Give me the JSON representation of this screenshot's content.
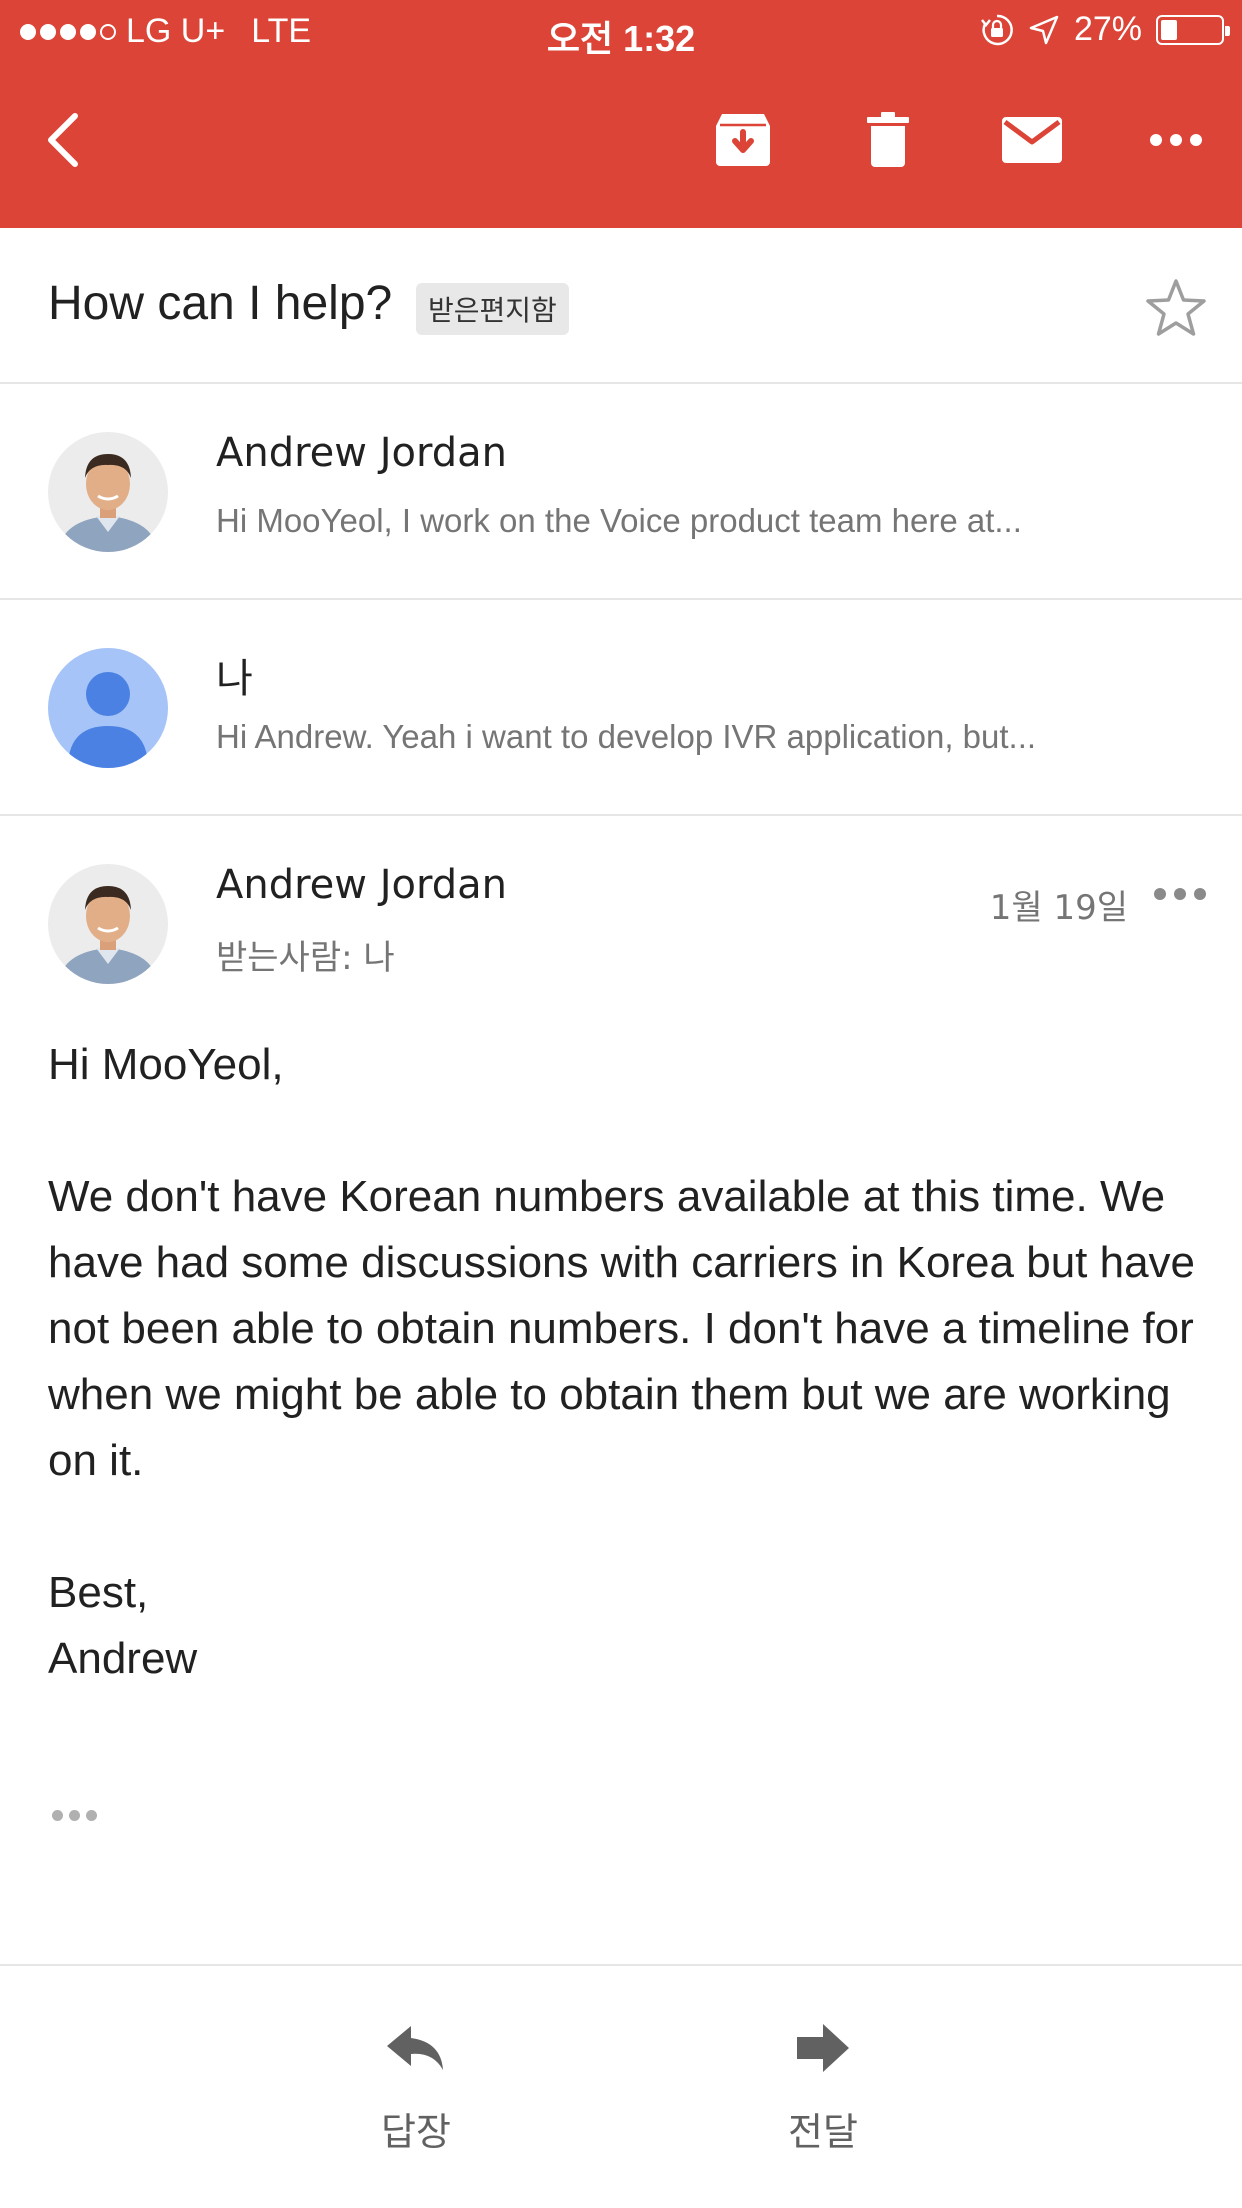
{
  "status_bar": {
    "carrier": "LG U+",
    "network": "LTE",
    "time": "오전 1:32",
    "battery_percent": "27%",
    "battery_level": 0.27,
    "signal_bars_filled": 4,
    "signal_bars_total": 5
  },
  "toolbar": {
    "icons": [
      "back-arrow-icon",
      "archive-icon",
      "trash-icon",
      "mail-icon",
      "more-horizontal-icon"
    ]
  },
  "thread": {
    "subject": "How can I help?",
    "label": "받은편지함",
    "starred": false
  },
  "messages": [
    {
      "sender": "Andrew Jordan",
      "snippet": "Hi MooYeol, I work on the Voice product team here at..."
    },
    {
      "sender": "나",
      "snippet": "Hi Andrew. Yeah i want to develop IVR application, but..."
    }
  ],
  "open_message": {
    "sender": "Andrew Jordan",
    "to_line": "받는사람: 나",
    "date": "1월 19일",
    "greeting": "Hi MooYeol,",
    "body": "We don't have Korean numbers available at this time. We have had some discussions with carriers in Korea but have not been able to obtain numbers. I don't have a timeline for when we might be able to obtain them but we are working on it.",
    "closing": "Best,",
    "signature": "Andrew"
  },
  "actions": {
    "reply_label": "답장",
    "forward_label": "전달"
  },
  "colors": {
    "header": "#dc4437",
    "default_avatar_bg": "#a6c4f7",
    "default_avatar_fg": "#4a81e3"
  }
}
